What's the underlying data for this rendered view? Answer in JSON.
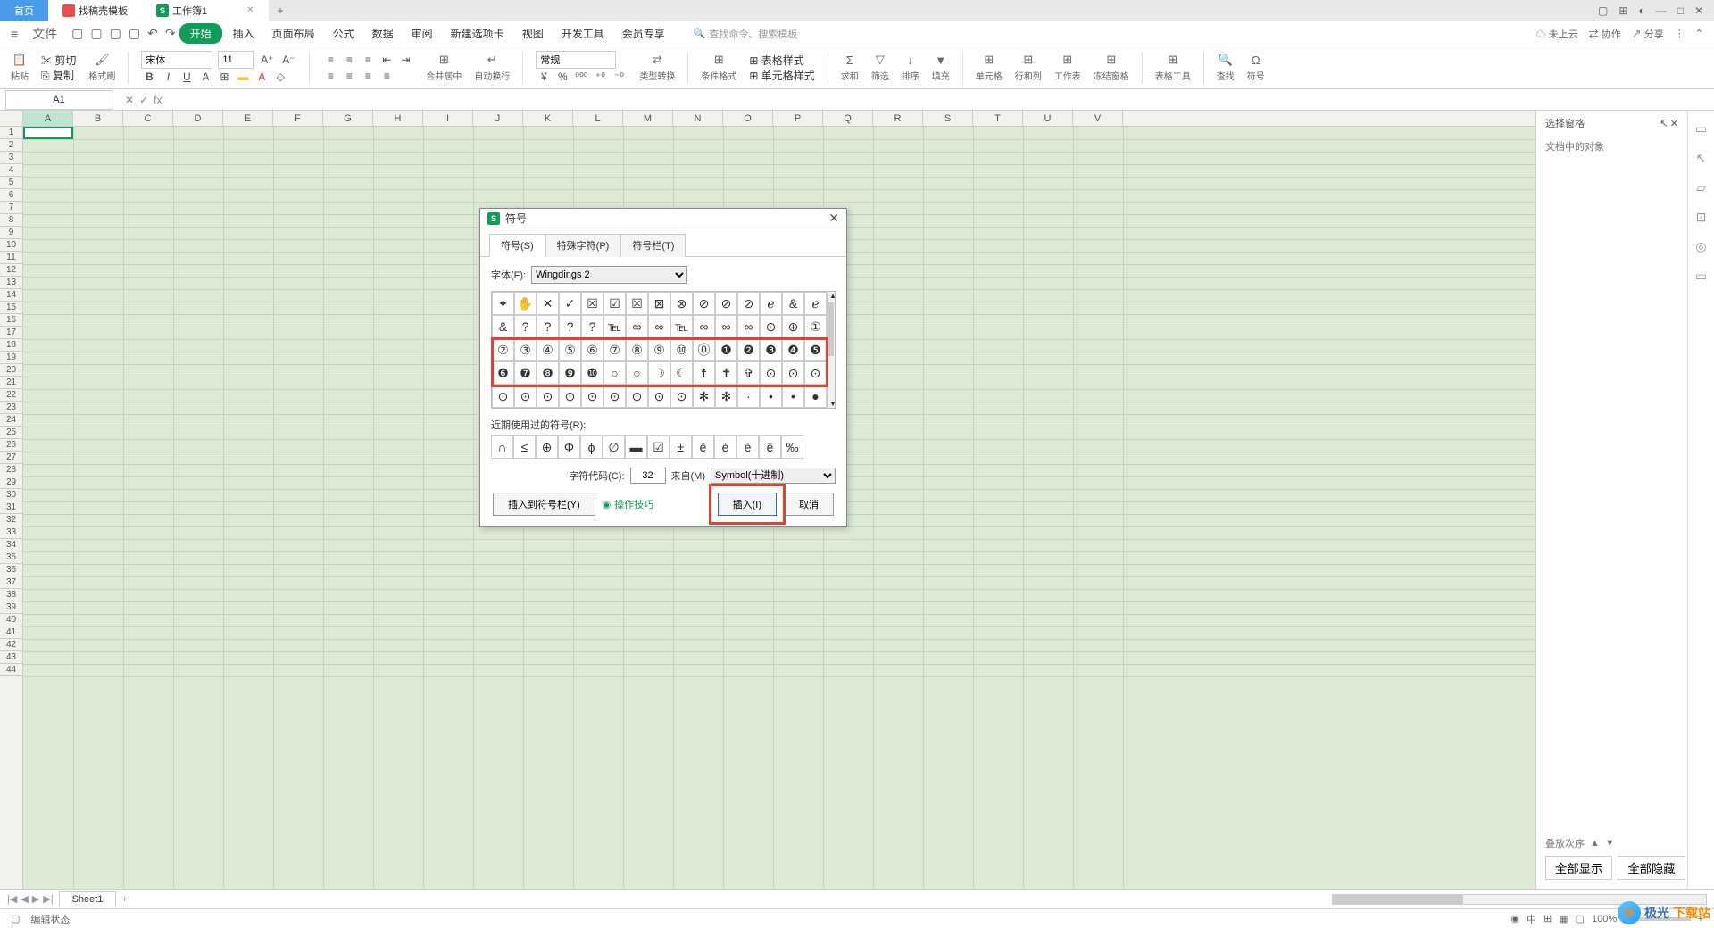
{
  "top_tabs": {
    "home": "首页",
    "template": "找稿壳模板",
    "workbook": "工作簿1"
  },
  "menu": {
    "file": "文件",
    "items": [
      "开始",
      "插入",
      "页面布局",
      "公式",
      "数据",
      "审阅",
      "新建选项卡",
      "视图",
      "开发工具",
      "会员专享"
    ],
    "search_placeholder": "查找命令、搜索模板",
    "cloud": "未上云",
    "collab": "协作",
    "share": "分享"
  },
  "ribbon": {
    "paste": "粘贴",
    "cut": "剪切",
    "copy": "复制",
    "format_painter": "格式刷",
    "font_name": "宋体",
    "font_size": "11",
    "merge": "合并居中",
    "wrap": "自动换行",
    "general": "常规",
    "type_convert": "类型转换",
    "cond_format": "条件格式",
    "table_style": "表格样式",
    "cell_style": "单元格样式",
    "sum": "求和",
    "filter": "筛选",
    "sort": "排序",
    "fill": "填充",
    "cell": "单元格",
    "rowcol": "行和列",
    "worksheet": "工作表",
    "freeze": "冻结窗格",
    "table_tool": "表格工具",
    "find": "查找",
    "symbol": "符号"
  },
  "formula_bar": {
    "cell_ref": "A1",
    "fx": "fx"
  },
  "columns": [
    "A",
    "B",
    "C",
    "D",
    "E",
    "F",
    "G",
    "H",
    "I",
    "J",
    "K",
    "L",
    "M",
    "N",
    "O",
    "P",
    "Q",
    "R",
    "S",
    "T",
    "U",
    "V"
  ],
  "right_panel": {
    "title": "选择窗格",
    "subtitle": "文档中的对象",
    "stack": "叠放次序",
    "show_all": "全部显示",
    "hide_all": "全部隐藏"
  },
  "sheet_tabs": {
    "sheet1": "Sheet1"
  },
  "status": {
    "edit": "编辑状态",
    "zoom": "100%"
  },
  "dialog": {
    "title": "符号",
    "tabs": [
      "符号(S)",
      "特殊字符(P)",
      "符号栏(T)"
    ],
    "font_label": "字体(F):",
    "font_value": "Wingdings 2",
    "symbols": [
      [
        "✦",
        "✋",
        "✕",
        "✓",
        "☒",
        "☑",
        "☒",
        "⊠",
        "⊗",
        "⊘",
        "⊘",
        "⊘",
        "ℯ",
        "&",
        "ℯ"
      ],
      [
        "&",
        "?",
        "?",
        "?",
        "?",
        "℡",
        "∞",
        "∞",
        "℡",
        "∞",
        "∞",
        "∞",
        "⊙",
        "⊕",
        "①"
      ],
      [
        "②",
        "③",
        "④",
        "⑤",
        "⑥",
        "⑦",
        "⑧",
        "⑨",
        "⑩",
        "⓪",
        "❶",
        "❷",
        "❸",
        "❹",
        "❺"
      ],
      [
        "❻",
        "❼",
        "❽",
        "❾",
        "❿",
        "○",
        "○",
        "☽",
        "☾",
        "☨",
        "✝",
        "✞",
        "⊙",
        "⊙",
        "⊙"
      ],
      [
        "⊙",
        "⊙",
        "⊙",
        "⊙",
        "⊙",
        "⊙",
        "⊙",
        "⊙",
        "⊙",
        "✻",
        "✻",
        "·",
        "•",
        "•",
        "●"
      ]
    ],
    "recent_label": "近期使用过的符号(R):",
    "recent": [
      "∩",
      "≤",
      "⊕",
      "Φ",
      "ϕ",
      "∅",
      "▬",
      "☑",
      "±",
      "ë",
      "é",
      "è",
      "ê",
      "‰"
    ],
    "code_label": "字符代码(C):",
    "code_value": "32",
    "from_label": "来自(M)",
    "from_value": "Symbol(十进制)",
    "add_to_bar": "插入到符号栏(Y)",
    "tips": "操作技巧",
    "insert": "插入(I)",
    "cancel": "取消"
  },
  "watermark": {
    "t1": "极光",
    "t2": "下载站"
  }
}
